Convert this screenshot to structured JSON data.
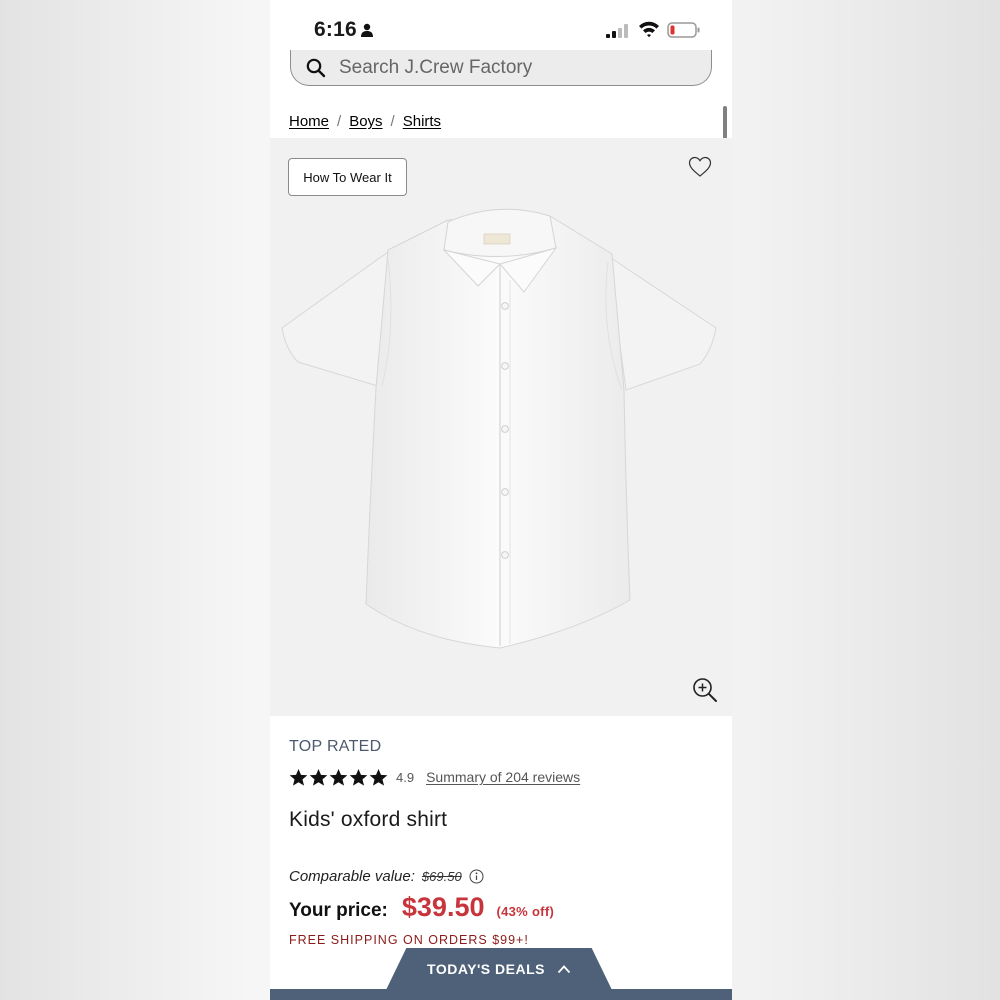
{
  "status_bar": {
    "time": "6:16"
  },
  "search": {
    "placeholder": "Search J.Crew Factory"
  },
  "breadcrumb": {
    "items": [
      "Home",
      "Boys",
      "Shirts"
    ],
    "separator": "/"
  },
  "image": {
    "how_to_wear_label": "How To Wear It"
  },
  "product": {
    "badge": "TOP RATED",
    "rating": "4.9",
    "rating_stars": 5,
    "reviews_link": "Summary of 204 reviews",
    "title": "Kids' oxford shirt",
    "comparable_label": "Comparable value:",
    "comparable_price": "$69.50",
    "price_label": "Your price:",
    "price": "$39.50",
    "discount": "(43% off)",
    "shipping_note": "FREE SHIPPING ON ORDERS $99+!"
  },
  "deals": {
    "label": "TODAY'S DEALS"
  },
  "colors": {
    "price_red": "#c8343c",
    "shipping_red": "#8b1a1a",
    "deals_bar": "#4e6178",
    "top_rated": "#4d5a6e"
  },
  "icons": [
    "person-icon",
    "signal-icon",
    "wifi-icon",
    "battery-icon",
    "search-icon",
    "heart-icon",
    "zoom-in-icon",
    "star-icon",
    "info-icon",
    "chevron-up-icon"
  ]
}
